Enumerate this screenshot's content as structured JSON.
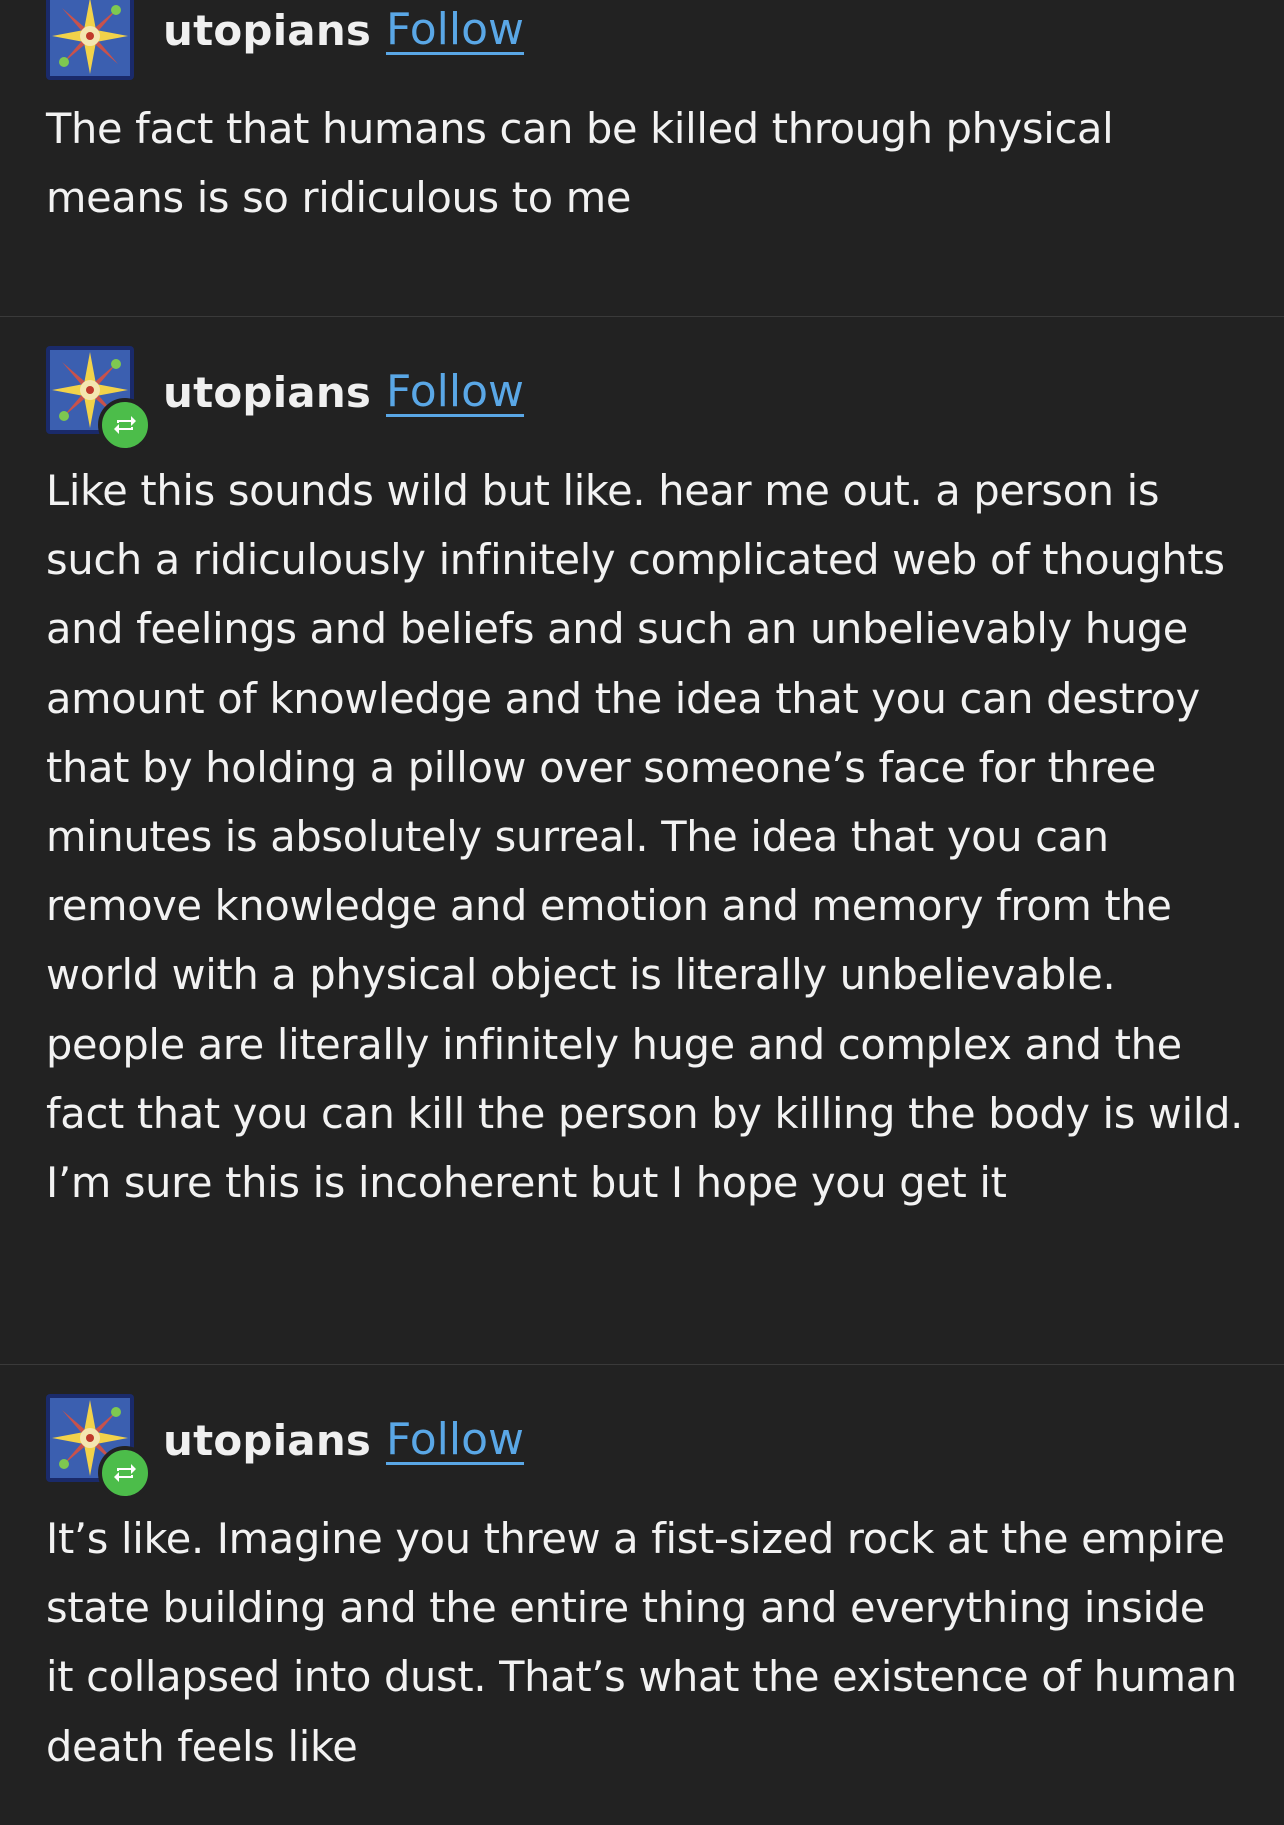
{
  "posts": [
    {
      "username": "utopians",
      "follow_label": "Follow",
      "reblog": false,
      "text": "The fact that humans can be killed through physical means is so ridiculous to me"
    },
    {
      "username": "utopians",
      "follow_label": "Follow",
      "reblog": true,
      "text": "Like this sounds wild but like. hear me out. a person is such a ridiculously infinitely complicated web of thoughts and feelings and beliefs and such an unbelievably huge amount of knowledge and the idea that you can destroy that by holding a pillow over someone’s face for three minutes is absolutely surreal. The idea that you can remove knowledge and emotion and memory from the world with a physical object is literally unbelievable. people are literally infinitely huge and complex and the fact that you can kill the person by killing the body is wild. I’m sure this is incoherent but I hope you get it"
    },
    {
      "username": "utopians",
      "follow_label": "Follow",
      "reblog": true,
      "text": "It’s like. Imagine you threw a fist-sized rock at the empire state building and the entire thing and everything inside it collapsed into dust. That’s what the existence of human death feels like"
    }
  ],
  "colors": {
    "background": "#222222",
    "text": "#f2f2f2",
    "link": "#5aa7e6",
    "reblog_badge": "#4cbd4a",
    "divider": "#3a3a3a"
  },
  "icons": {
    "avatar": "avatar-art",
    "reblog": "reblog-icon"
  }
}
